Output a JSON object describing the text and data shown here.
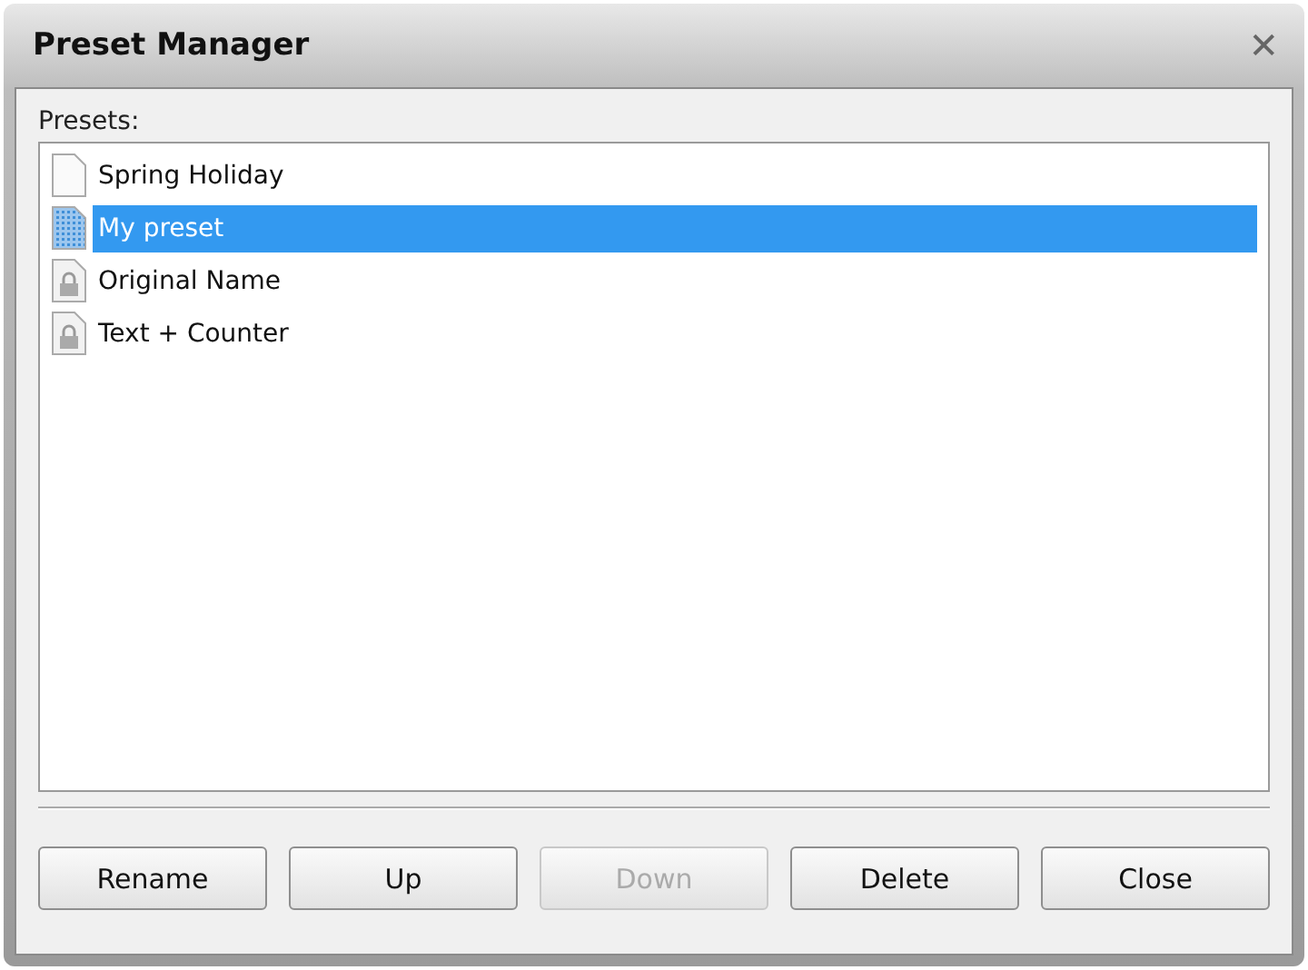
{
  "window": {
    "title": "Preset Manager",
    "close": "✕"
  },
  "presets": {
    "label": "Presets:",
    "items": [
      {
        "name": "Spring Holiday",
        "kind": "document",
        "selected": false
      },
      {
        "name": "My preset",
        "kind": "document",
        "selected": true
      },
      {
        "name": "Original Name",
        "kind": "locked",
        "selected": false
      },
      {
        "name": "Text + Counter",
        "kind": "locked",
        "selected": false
      }
    ]
  },
  "buttons": [
    {
      "label": "Rename",
      "disabled": false
    },
    {
      "label": "Up",
      "disabled": false
    },
    {
      "label": "Down",
      "disabled": true
    },
    {
      "label": "Delete",
      "disabled": false
    },
    {
      "label": "Close",
      "disabled": false
    }
  ]
}
